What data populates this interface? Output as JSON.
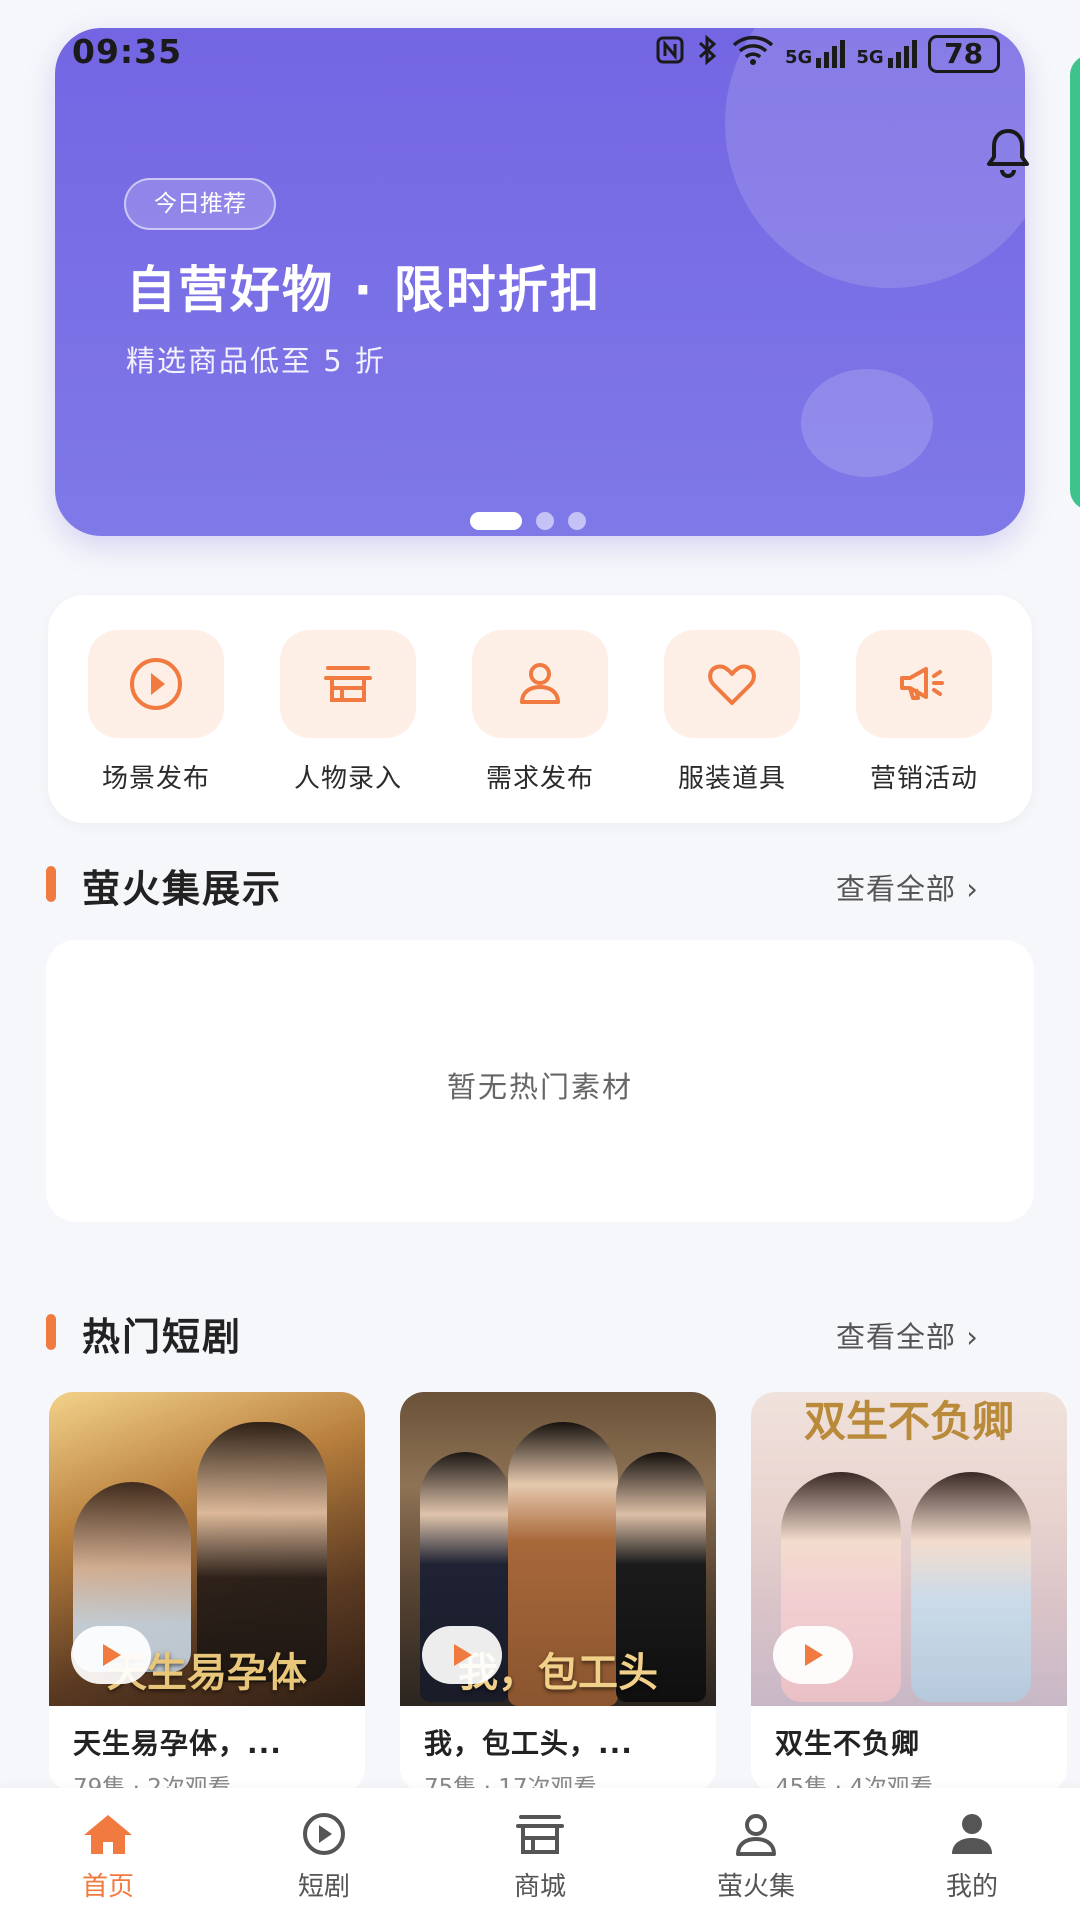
{
  "status_bar": {
    "time": "09:35",
    "network_1": "5G",
    "network_2": "5G",
    "battery": "78"
  },
  "banner": {
    "tag": "今日推荐",
    "title": "自营好物 · 限时折扣",
    "subtitle": "精选商品低至 5 折",
    "active_slide": 1,
    "slide_count": 3
  },
  "quick_actions": [
    {
      "label": "场景发布",
      "icon": "play-circle-icon"
    },
    {
      "label": "人物录入",
      "icon": "store-icon"
    },
    {
      "label": "需求发布",
      "icon": "user-icon"
    },
    {
      "label": "服装道具",
      "icon": "heart-icon"
    },
    {
      "label": "营销活动",
      "icon": "megaphone-icon"
    }
  ],
  "firefly_section": {
    "title": "萤火集展示",
    "more": "查看全部 ›",
    "empty_text": "暂无热门素材"
  },
  "hot_section": {
    "title": "热门短剧",
    "more": "查看全部 ›",
    "dramas": [
      {
        "poster_text": "天生易孕体",
        "title": "天生易孕体，...",
        "meta": "79集 · 2次观看"
      },
      {
        "poster_text": "我，包工头",
        "title": "我，包工头，...",
        "meta": "75集 · 17次观看"
      },
      {
        "poster_text": "双生不负卿",
        "title": "双生不负卿",
        "meta": "45集 · 4次观看"
      }
    ]
  },
  "bottom_nav": [
    {
      "label": "首页",
      "icon": "home-icon",
      "active": true
    },
    {
      "label": "短剧",
      "icon": "play-circle-icon",
      "active": false
    },
    {
      "label": "商城",
      "icon": "store-icon",
      "active": false
    },
    {
      "label": "萤火集",
      "icon": "user-icon",
      "active": false
    },
    {
      "label": "我的",
      "icon": "profile-icon",
      "active": false
    }
  ],
  "colors": {
    "accent": "#f07a3f",
    "banner": "#7466e3",
    "icon_bg": "#fdeee6"
  }
}
